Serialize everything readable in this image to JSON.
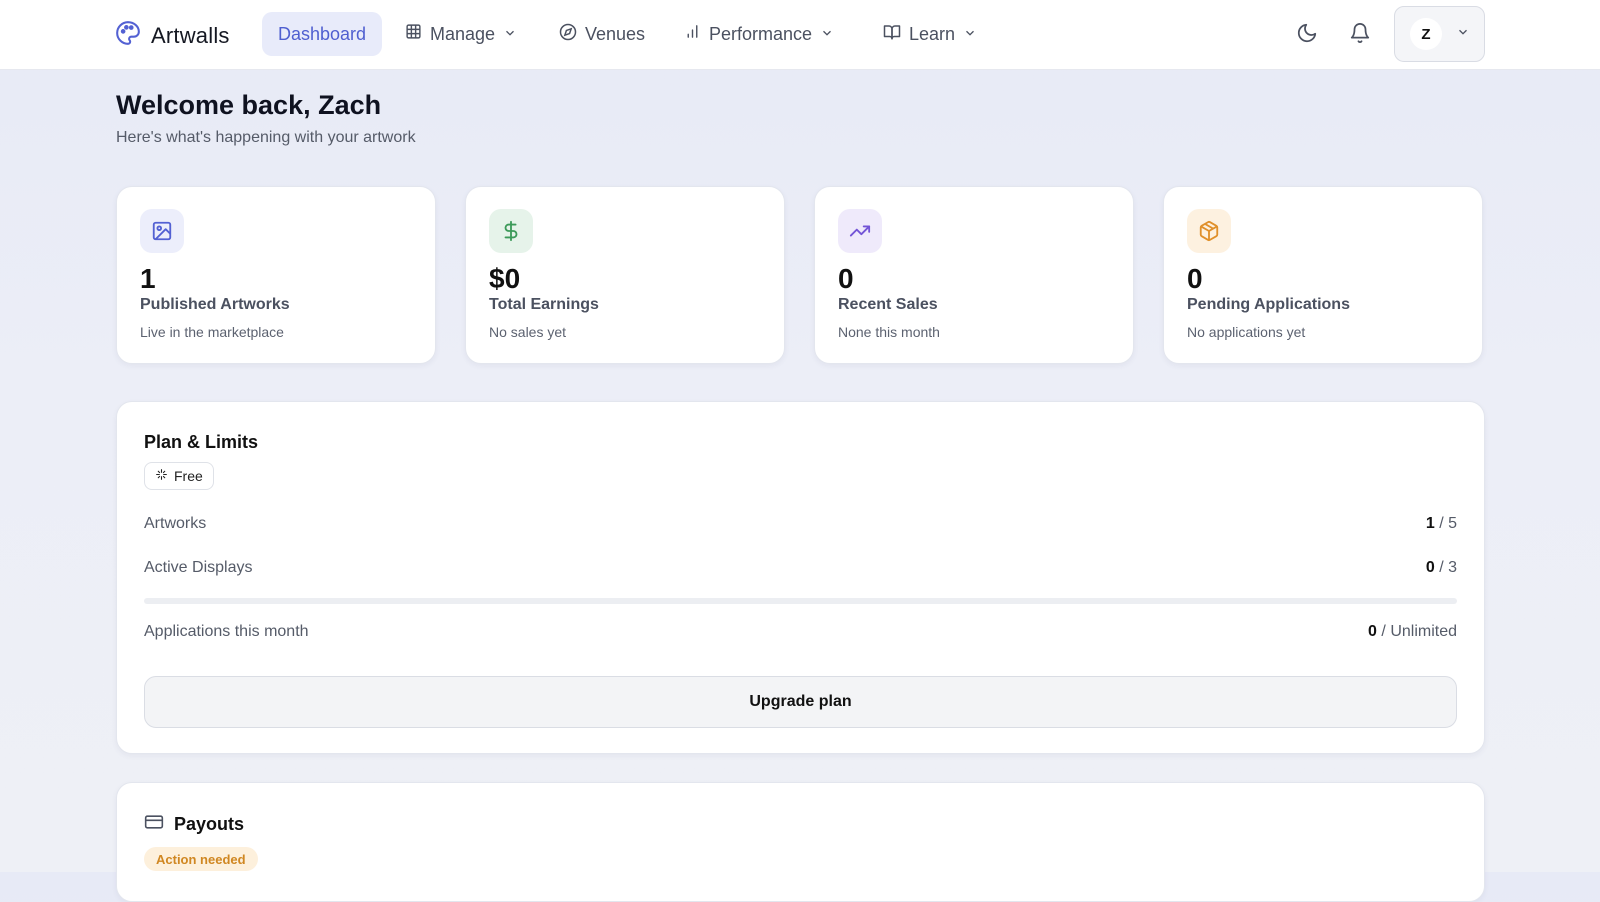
{
  "brand": {
    "name": "Artwalls",
    "accent": "#4f5fd0"
  },
  "nav": {
    "items": [
      {
        "label": "Dashboard",
        "icon": "none",
        "active": true
      },
      {
        "label": "Manage",
        "icon": "grid-icon",
        "dropdown": true
      },
      {
        "label": "Venues",
        "icon": "compass-icon"
      },
      {
        "label": "Performance",
        "icon": "bar-chart-icon",
        "dropdown": true
      },
      {
        "label": "Learn",
        "icon": "book-icon",
        "dropdown": true
      }
    ],
    "user_initial": "Z"
  },
  "header": {
    "title": "Welcome back, Zach",
    "subtitle": "Here's what's happening with your artwork"
  },
  "stats": [
    {
      "value": "1",
      "label": "Published Artworks",
      "sub": "Live in the marketplace",
      "icon": "image-icon",
      "color": "#5361d3"
    },
    {
      "value": "$0",
      "label": "Total Earnings",
      "sub": "No sales yet",
      "icon": "dollar-icon",
      "color": "#3d9a5a"
    },
    {
      "value": "0",
      "label": "Recent Sales",
      "sub": "None this month",
      "icon": "trending-up-icon",
      "color": "#7354d6"
    },
    {
      "value": "0",
      "label": "Pending Applications",
      "sub": "No applications yet",
      "icon": "package-icon",
      "color": "#e0902a"
    }
  ],
  "plan": {
    "title": "Plan & Limits",
    "badge": "Free",
    "rows": [
      {
        "label": "Artworks",
        "used": "1",
        "limit": "5"
      },
      {
        "label": "Active Displays",
        "used": "0",
        "limit": "3"
      },
      {
        "label": "Applications this month",
        "used": "0",
        "limit": "Unlimited"
      }
    ],
    "displays_progress": 0,
    "separator": "/",
    "upgrade_label": "Upgrade plan"
  },
  "payouts": {
    "title": "Payouts",
    "badge": "Action needed"
  }
}
